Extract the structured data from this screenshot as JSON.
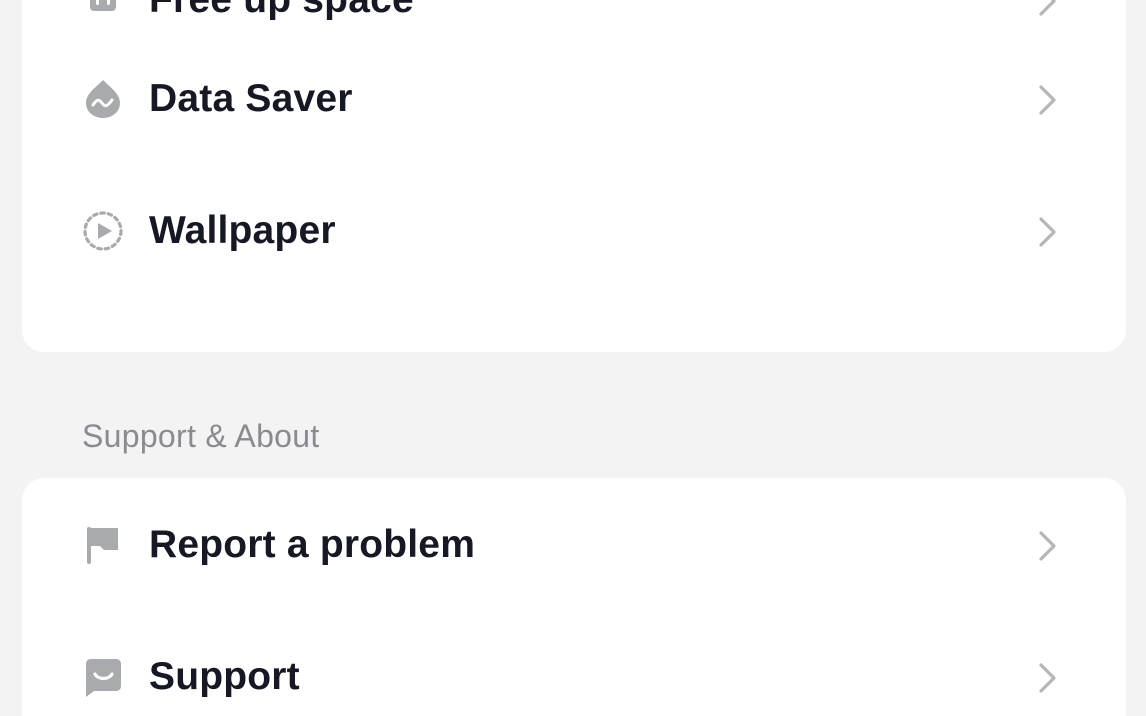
{
  "settings_group_top": {
    "items": [
      {
        "label": "Free up space",
        "icon": "trash-icon"
      },
      {
        "label": "Data Saver",
        "icon": "data-saver-icon"
      },
      {
        "label": "Wallpaper",
        "icon": "wallpaper-icon"
      }
    ]
  },
  "support_section": {
    "title": "Support & About",
    "items": [
      {
        "label": "Report a problem",
        "icon": "flag-icon"
      },
      {
        "label": "Support",
        "icon": "chat-bubble-icon"
      }
    ]
  },
  "colors": {
    "background": "#f3f3f3",
    "card": "#ffffff",
    "text": "#161823",
    "section_title": "#8a8b91",
    "icon": "#a9aaae",
    "chevron": "#b5b6ba"
  }
}
